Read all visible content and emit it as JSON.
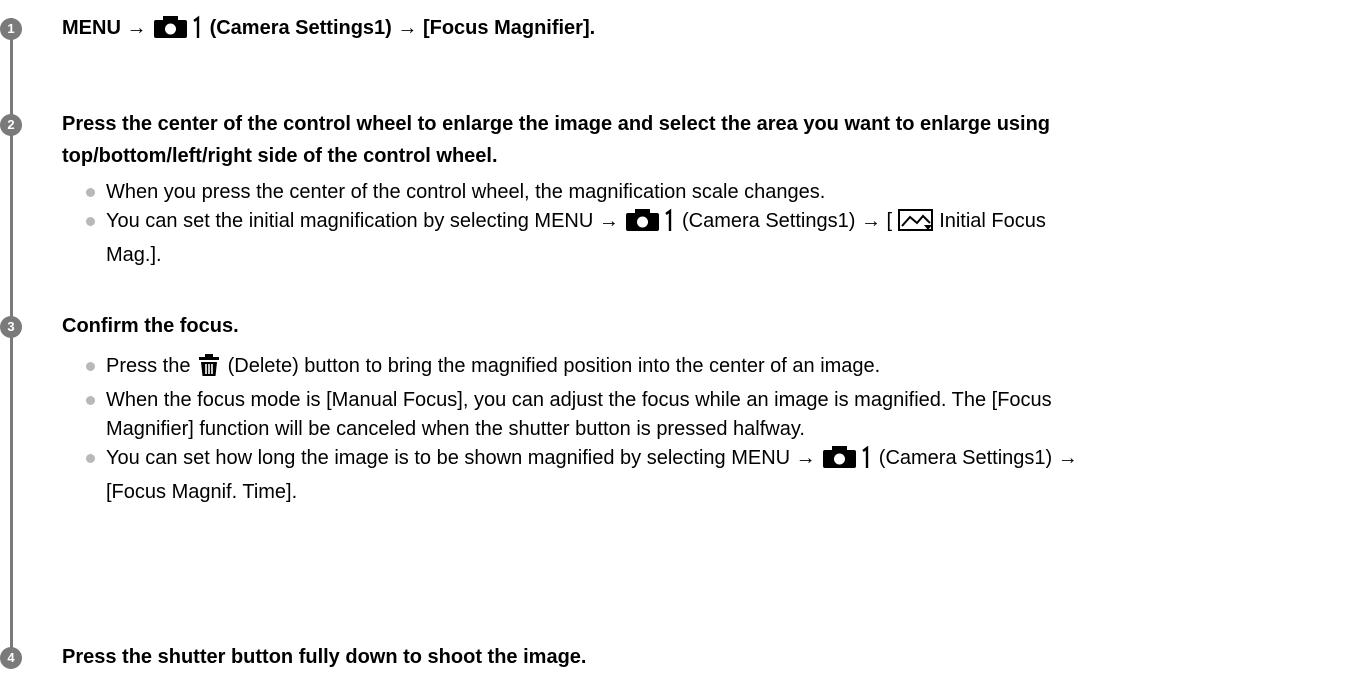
{
  "steps": [
    {
      "number": "1",
      "title_parts": [
        "MENU → ",
        "(Camera Settings1) → [Focus Magnifier]."
      ]
    },
    {
      "number": "2",
      "title_line1": "Press the center of the control wheel to enlarge the image and select the area you want to enlarge using",
      "title_line2": "top/bottom/left/right side of the control wheel.",
      "bullets": [
        {
          "text": "When you press the center of the control wheel, the magnification scale changes."
        },
        {
          "part1": "You can set the initial magnification by selecting MENU → ",
          "part2": "(Camera Settings1) → [",
          "part3": "Initial Focus",
          "part4": "Mag.]."
        }
      ]
    },
    {
      "number": "3",
      "title": "Confirm the focus.",
      "bullets": [
        {
          "part1": "Press the ",
          "part2": "(Delete) button to bring the magnified position into the center of an image."
        },
        {
          "line1": "When the focus mode is [Manual Focus], you can adjust the focus while an image is magnified. The [Focus",
          "line2": "Magnifier] function will be canceled when the shutter button is pressed halfway."
        },
        {
          "part1": "You can set how long the image is to be shown magnified by selecting MENU → ",
          "part2": "(Camera Settings1) →",
          "part3": "[Focus Magnif. Time]."
        }
      ]
    },
    {
      "number": "4",
      "title": "Press the shutter button fully down to shoot the image."
    }
  ],
  "icons": {
    "camera_settings": "camera-settings-1-icon",
    "initial_focus_mag": "initial-focus-mag-icon",
    "delete": "delete-trash-icon"
  },
  "colors": {
    "rail": "#7a7a7a",
    "badge": "#7a7a7a",
    "bullet": "#b8b8b8",
    "text": "#000000"
  }
}
